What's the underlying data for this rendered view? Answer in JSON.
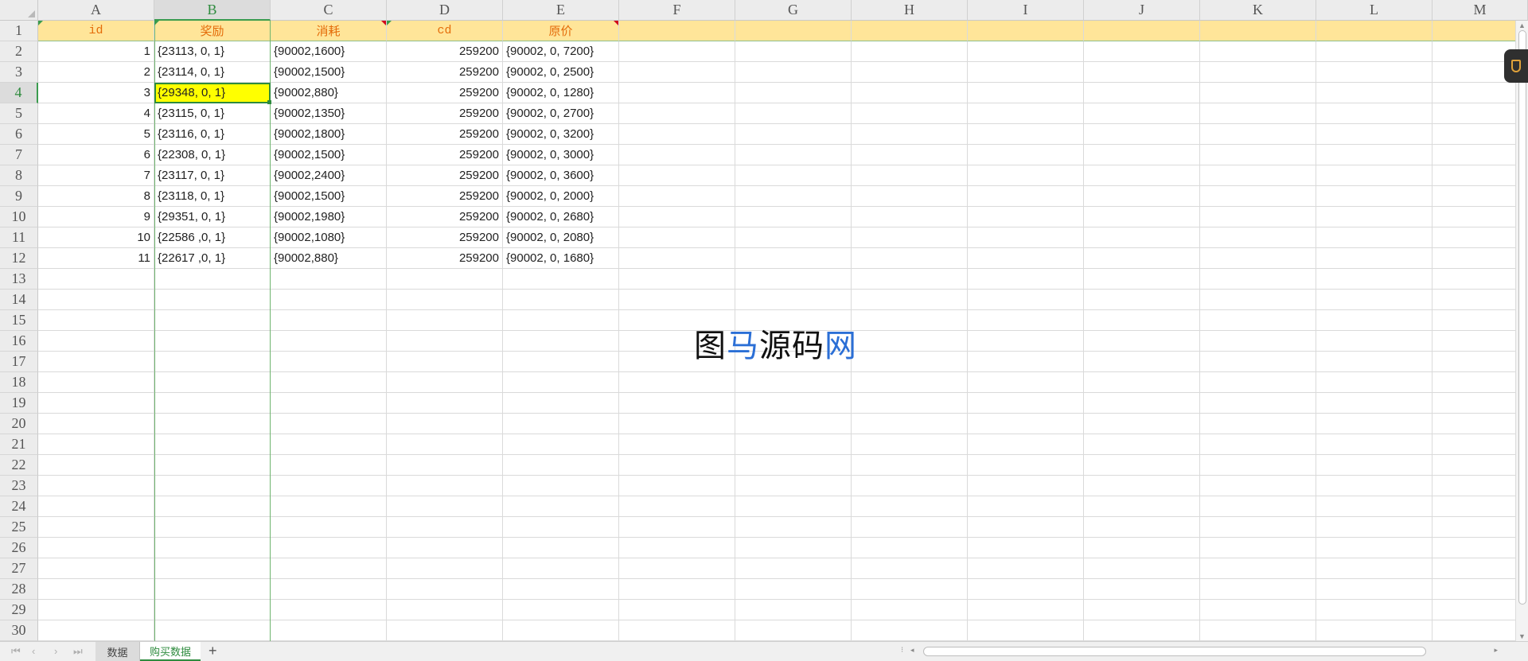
{
  "columns": [
    "A",
    "B",
    "C",
    "D",
    "E",
    "F",
    "G",
    "H",
    "I",
    "J",
    "K",
    "L",
    "M"
  ],
  "selected_column": "B",
  "selected_row": 4,
  "row_numbers": [
    1,
    2,
    3,
    4,
    5,
    6,
    7,
    8,
    9,
    10,
    11,
    12,
    13,
    14,
    15,
    16,
    17,
    18,
    19,
    20,
    21,
    22,
    23,
    24,
    25,
    26,
    27,
    28,
    29,
    30
  ],
  "header_row": [
    "id",
    "奖励",
    "消耗",
    "cd",
    "原价"
  ],
  "header_fill": "#ffe599",
  "header_text_color": "#e46c0a",
  "active_cell_fill": "#ffff00",
  "accent_color": "#2e8b3e",
  "rows": [
    [
      "1",
      "{23113, 0, 1}",
      "{90002,1600}",
      "259200",
      "{90002, 0, 7200}"
    ],
    [
      "2",
      "{23114, 0, 1}",
      "{90002,1500}",
      "259200",
      "{90002, 0, 2500}"
    ],
    [
      "3",
      "{29348, 0, 1}",
      "{90002,880}",
      "259200",
      "{90002, 0, 1280}"
    ],
    [
      "4",
      "{23115, 0, 1}",
      "{90002,1350}",
      "259200",
      "{90002, 0, 2700}"
    ],
    [
      "5",
      "{23116, 0, 1}",
      "{90002,1800}",
      "259200",
      "{90002, 0, 3200}"
    ],
    [
      "6",
      "{22308, 0, 1}",
      "{90002,1500}",
      "259200",
      "{90002, 0, 3000}"
    ],
    [
      "7",
      "{23117, 0, 1}",
      "{90002,2400}",
      "259200",
      "{90002, 0, 3600}"
    ],
    [
      "8",
      "{23118, 0, 1}",
      "{90002,1500}",
      "259200",
      "{90002, 0, 2000}"
    ],
    [
      "9",
      "{29351, 0, 1}",
      "{90002,1980}",
      "259200",
      "{90002, 0, 2680}"
    ],
    [
      "10",
      "{22586 ,0, 1}",
      "{90002,1080}",
      "259200",
      "{90002, 0, 2080}"
    ],
    [
      "11",
      "{22617 ,0, 1}",
      "{90002,880}",
      "259200",
      "{90002, 0, 1680}"
    ]
  ],
  "watermark": {
    "part1": "图",
    "part2": "马",
    "part3": "源码",
    "part4": "网"
  },
  "sheet_tabs": [
    {
      "label": "数据",
      "active": false
    },
    {
      "label": "购买数据",
      "active": true
    }
  ],
  "add_sheet_label": "+",
  "tab_nav_icons": [
    "first-sheet-icon",
    "prev-sheet-icon",
    "next-sheet-icon",
    "last-sheet-icon"
  ]
}
